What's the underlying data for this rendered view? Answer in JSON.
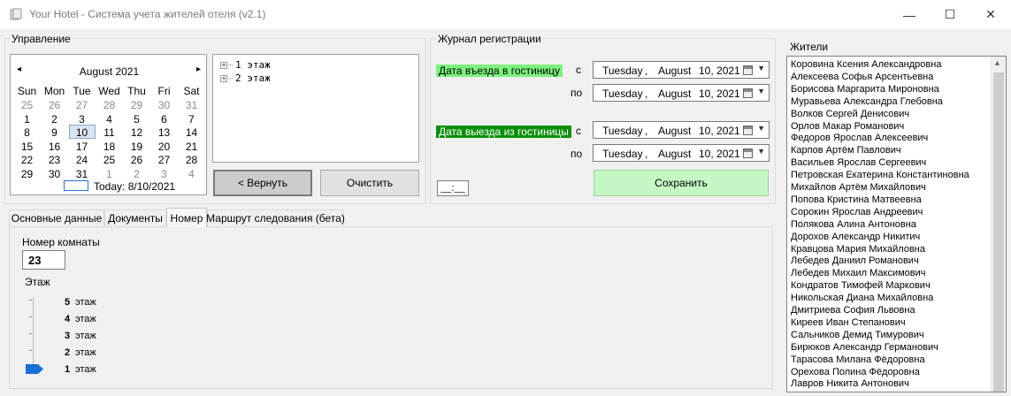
{
  "window": {
    "title": "Your Hotel - Система учета жителей отеля (v2.1)",
    "minimize": "—",
    "maximize": "☐",
    "close": "✕"
  },
  "management": {
    "label": "Управление",
    "calendar": {
      "prev": "◂",
      "next": "▸",
      "month_label": "August 2021",
      "weekdays": [
        "Sun",
        "Mon",
        "Tue",
        "Wed",
        "Thu",
        "Fri",
        "Sat"
      ],
      "weeks": [
        [
          "25",
          "26",
          "27",
          "28",
          "29",
          "30",
          "31"
        ],
        [
          "1",
          "2",
          "3",
          "4",
          "5",
          "6",
          "7"
        ],
        [
          "8",
          "9",
          "10",
          "11",
          "12",
          "13",
          "14"
        ],
        [
          "15",
          "16",
          "17",
          "18",
          "19",
          "20",
          "21"
        ],
        [
          "22",
          "23",
          "24",
          "25",
          "26",
          "27",
          "28"
        ],
        [
          "29",
          "30",
          "31",
          "1",
          "2",
          "3",
          "4"
        ]
      ],
      "selected": "10",
      "today_label": "Today: 8/10/2021"
    },
    "tree": [
      "1 этаж",
      "2 этаж"
    ],
    "back_button": "< Вернуть",
    "clear_button": "Очистить"
  },
  "journal": {
    "label": "Журнал регистрации",
    "checkin_label": "Дата въезда в гостиницу",
    "checkout_label": "Дата выезда из гостиницы",
    "from_label": "с",
    "to_label": "по",
    "dates": {
      "checkin_from": {
        "weekday": "Tuesday",
        "sep": ",",
        "month": "August",
        "day_year": "10, 2021"
      },
      "checkin_to": {
        "weekday": "Tuesday",
        "sep": ",",
        "month": "August",
        "day_year": "10, 2021"
      },
      "checkout_from": {
        "weekday": "Tuesday",
        "sep": ",",
        "month": "August",
        "day_year": "10, 2021"
      },
      "checkout_to": {
        "weekday": "Tuesday",
        "sep": ",",
        "month": "August",
        "day_year": "10, 2021"
      }
    },
    "time_value": "__:__",
    "save_button": "Сохранить",
    "colors": {
      "checkin_bg": "#7cf27c",
      "checkout_bg": "#0a8f0a",
      "save_bg": "#c4f7c4"
    }
  },
  "tabs": {
    "items": [
      "Основные данные",
      "Документы",
      "Номер",
      "Маршрут следования (бета)"
    ],
    "active": "Номер"
  },
  "room": {
    "room_label": "Номер комнаты",
    "room_value": "23",
    "floor_label": "Этаж",
    "floors": [
      {
        "num": "5",
        "label": "этаж"
      },
      {
        "num": "4",
        "label": "этаж"
      },
      {
        "num": "3",
        "label": "этаж"
      },
      {
        "num": "2",
        "label": "этаж"
      },
      {
        "num": "1",
        "label": "этаж"
      }
    ],
    "selected_floor": "1",
    "slider_color": "#1a6fd6"
  },
  "residents": {
    "label": "Жители",
    "items": [
      "Коровина Ксения Александровна",
      "Алексеева Софья Арсентьевна",
      "Борисова Маргарита Мироновна",
      "Муравьева Александра Глебовна",
      "Волков Сергей Денисович",
      "Орлов Макар Романович",
      "Федоров Ярослав Алексеевич",
      "Карпов Артём Павлович",
      "Васильев Ярослав Сергеевич",
      "Петровская Екатерина Константиновна",
      "Михайлов Артём Михайлович",
      "Попова Кристина Матвеевна",
      "Сорокин Ярослав Андреевич",
      "Полякова Алина Антоновна",
      "Дорохов Александр Никитич",
      "Кравцова Мария Михайловна",
      "Лебедев Даниил Романович",
      "Лебедев Михаил Максимович",
      "Кондратов Тимофей Маркович",
      "Никольская Диана Михайловна",
      "Дмитриева София Львовна",
      "Киреев Иван Степанович",
      "Сальников Демид Тимурович",
      "Бирюков Александр Германович",
      "Тарасова Милана Фёдоровна",
      "Орехова Полина Фёдоровна",
      "Лавров Никита Антонович"
    ],
    "scroll_up": "▴",
    "scroll_down": "▾"
  }
}
